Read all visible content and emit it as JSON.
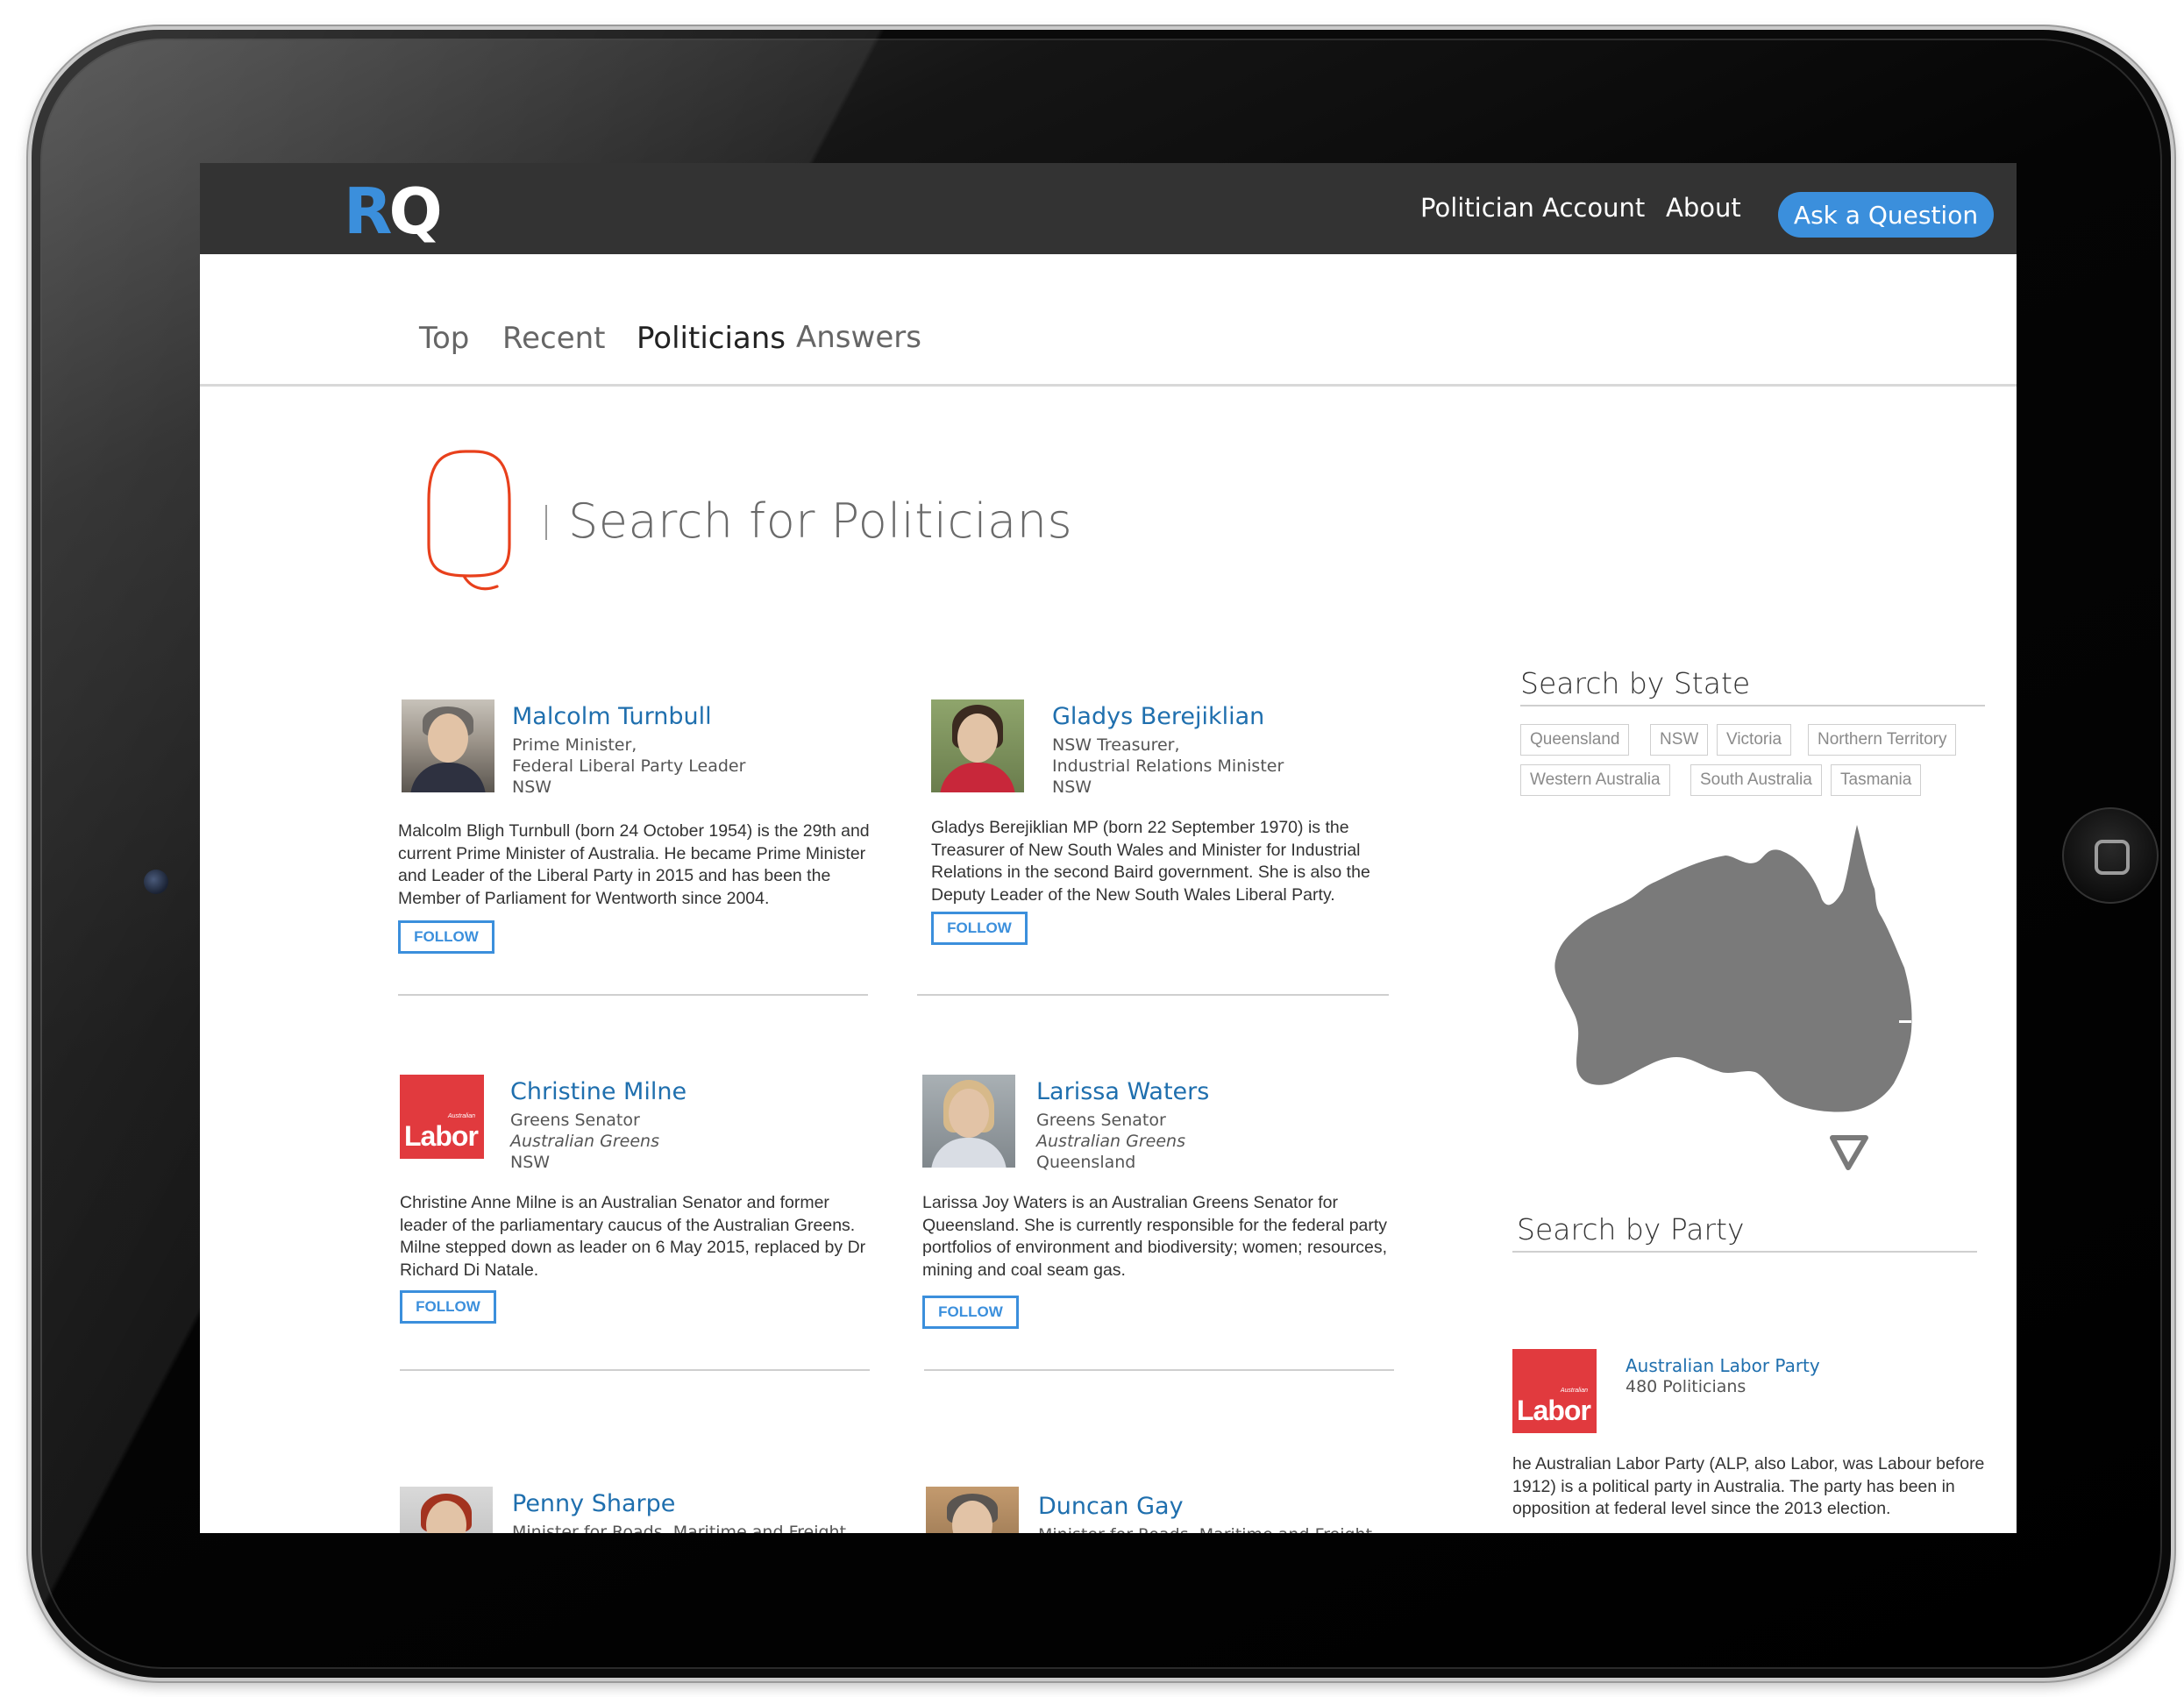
{
  "header": {
    "logo_r": "R",
    "logo_q": "Q",
    "nav": [
      "Politician Account",
      "About"
    ],
    "ask_button": "Ask a Question"
  },
  "tabs": [
    "Top",
    "Recent",
    "Politicians",
    "Answers"
  ],
  "active_tab": "Politicians",
  "search": {
    "title": "Search for Politicians"
  },
  "politicians": [
    {
      "name": "Malcolm Turnbull",
      "role": [
        "Prime Minister,",
        "Federal Liberal Party Leader",
        "NSW"
      ],
      "bio": "Malcolm Bligh Turnbull (born 24 October 1954) is the 29th and current Prime Minister of Australia. He became Prime Minister and Leader of the Liberal Party in 2015 and has been the Member of Parliament for Wentworth since 2004.",
      "follow": "FOLLOW"
    },
    {
      "name": "Gladys Berejiklian",
      "role": [
        "NSW Treasurer,",
        "Industrial Relations Minister",
        "NSW"
      ],
      "bio": "Gladys Berejiklian MP (born 22 September 1970) is the Treasurer of New South Wales and Minister for Industrial Relations in the second Baird government. She is also the Deputy Leader of the New South Wales Liberal Party.",
      "follow": "FOLLOW"
    },
    {
      "name": "Christine Milne",
      "role": [
        "Greens Senator",
        "Australian Greens",
        "NSW"
      ],
      "bio": "Christine Anne Milne is an Australian Senator and former leader of the parliamentary caucus of the Australian Greens. Milne stepped down as leader on 6 May 2015, replaced by Dr Richard Di Natale.",
      "follow": "FOLLOW",
      "logo_small": "Australian",
      "logo_big": "Labor"
    },
    {
      "name": "Larissa Waters",
      "role": [
        "Greens Senator",
        "Australian Greens",
        "Queensland"
      ],
      "bio": "Larissa Joy Waters is an Australian Greens Senator for Queensland. She is currently responsible for the federal party portfolios of environment and biodiversity; women; resources, mining and coal seam gas.",
      "follow": "FOLLOW"
    },
    {
      "name": "Penny Sharpe",
      "role": [
        "Minister for Roads, Maritime and Freight"
      ]
    },
    {
      "name": "Duncan Gay",
      "role": [
        "Minister for Roads, Maritime and Freight"
      ]
    }
  ],
  "sidebar": {
    "state_title": "Search by State",
    "states": [
      "Queensland",
      "NSW",
      "Victoria",
      "Northern Territory",
      "Western Australia",
      "South Australia",
      "Tasmania"
    ],
    "party_title": "Search by Party",
    "party": {
      "name": "Australian Labor Party",
      "count": "480 Politicians",
      "logo_small": "Australian",
      "logo_big": "Labor",
      "desc": "he Australian Labor Party (ALP, also Labor, was Labour before 1912) is a political party in Australia. The party has been in opposition at federal level since the 2013 election."
    }
  },
  "colors": {
    "accent_blue": "#3b8fdc",
    "name_blue": "#1f6fae",
    "q_mark_red": "#e8401c",
    "topbar": "#333333",
    "map_gray": "#7a7a7a",
    "labor_red": "#e13a3e"
  },
  "icons": [
    "search-q-icon",
    "australia-map-icon",
    "home-button-icon"
  ]
}
